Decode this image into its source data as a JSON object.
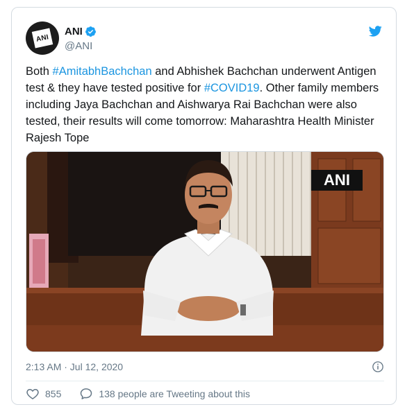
{
  "tweet": {
    "author_name": "ANI",
    "author_handle": "@ANI",
    "avatar_logo_text": "ANI",
    "text_segments": {
      "s1": "Both ",
      "h1": "#AmitabhBachchan",
      "s2": " and Abhishek Bachchan underwent Antigen test & they have tested positive for ",
      "h2": "#COVID19",
      "s3": ". Other family members including Jaya Bachchan and Aishwarya Rai Bachchan were also tested, their results will come tomorrow: Maharashtra Health Minister Rajesh Tope"
    },
    "media_watermark": "ANI",
    "timestamp": "2:13 AM · Jul 12, 2020",
    "like_count": "855",
    "retweet_text": "138 people are Tweeting about this"
  },
  "colors": {
    "link": "#1b95e0",
    "secondary_text": "#657786",
    "twitter_blue": "#1da1f2"
  },
  "icons": {
    "verified": "verified-badge-icon",
    "brand": "twitter-bird-icon",
    "info": "info-icon",
    "like": "heart-icon",
    "discuss": "speech-bubble-icon"
  }
}
